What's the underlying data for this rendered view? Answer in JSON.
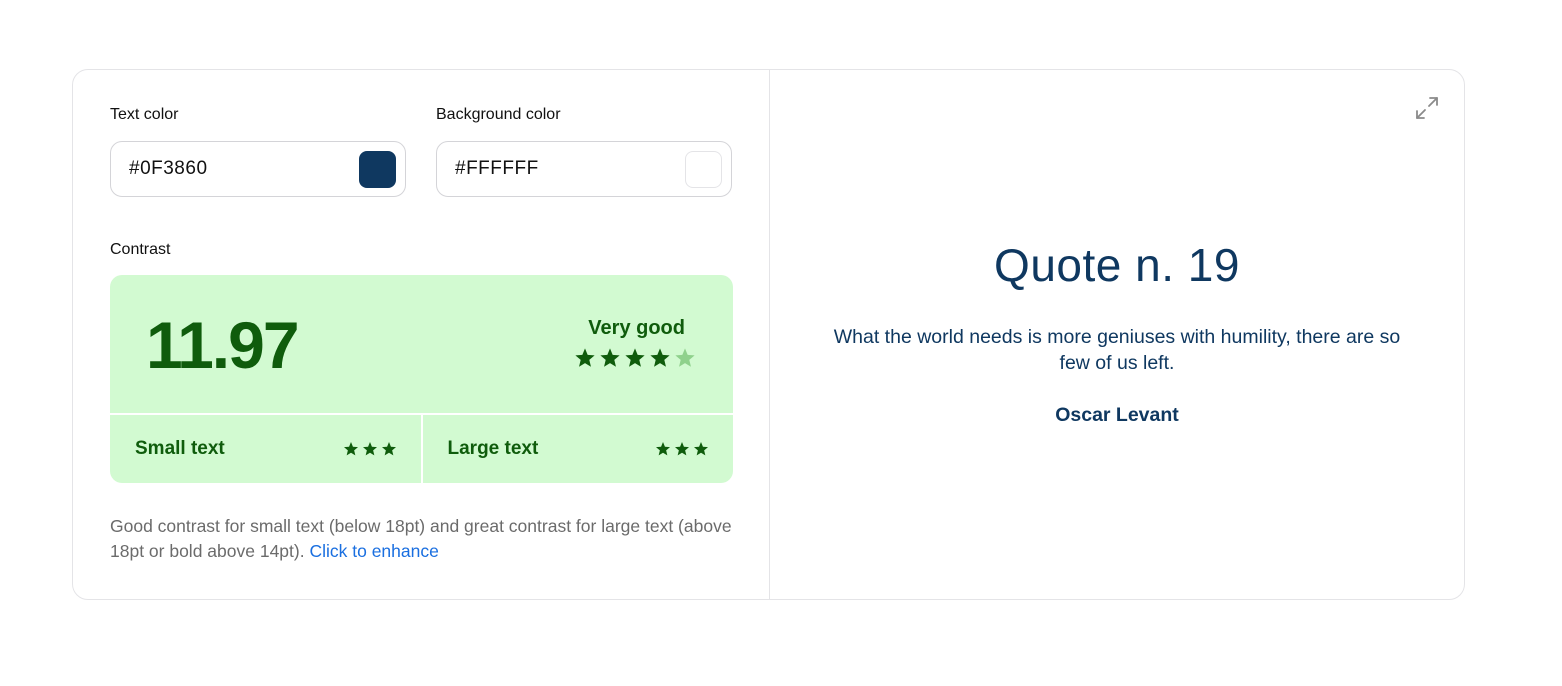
{
  "text_color": {
    "label": "Text color",
    "value": "#0F3860",
    "swatch": "#0F3860"
  },
  "background_color": {
    "label": "Background color",
    "value": "#FFFFFF",
    "swatch": "#FFFFFF"
  },
  "contrast": {
    "label": "Contrast",
    "ratio": "11.97",
    "rating": "Very good",
    "rating_stars": 4,
    "rating_max": 5,
    "small_text": {
      "label": "Small text",
      "stars": 3
    },
    "large_text": {
      "label": "Large text",
      "stars": 3
    },
    "description": "Good contrast for small text (below 18pt) and great contrast for large text (above 18pt or bold above 14pt).",
    "enhance_link": "Click to enhance"
  },
  "preview": {
    "title": "Quote n. 19",
    "text": "What the world needs is more geniuses with humility, there are so few of us left.",
    "author": "Oscar Levant",
    "expand_icon": "expand-icon"
  },
  "colors": {
    "good_bg": "#d2fad1",
    "good_fg": "#0f5c0c",
    "star_dim": "#8fd18c",
    "link": "#1a6fe0"
  }
}
